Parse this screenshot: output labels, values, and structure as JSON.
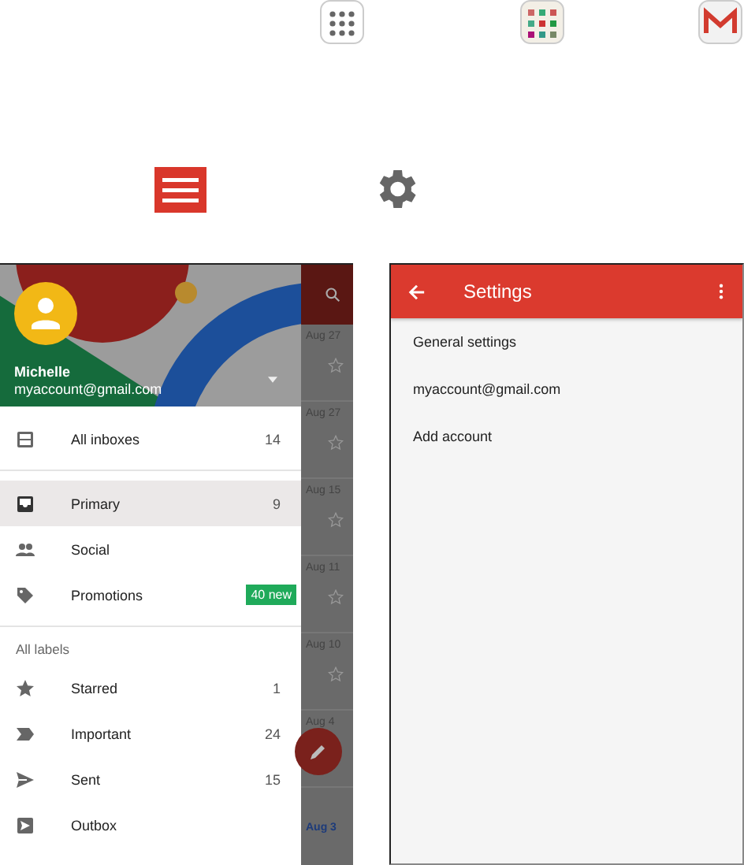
{
  "drawer": {
    "account": {
      "name": "Michelle",
      "email": "myaccount@gmail.com"
    },
    "groups": [
      {
        "items": [
          {
            "label": "All inboxes",
            "count": "14",
            "selected": false
          }
        ]
      },
      {
        "items": [
          {
            "label": "Primary",
            "count": "9",
            "selected": true
          },
          {
            "label": "Social",
            "selected": false
          },
          {
            "label": "Promotions",
            "badge": "40 new",
            "selected": false
          }
        ]
      },
      {
        "heading": "All labels",
        "items": [
          {
            "label": "Starred",
            "count": "1",
            "selected": false
          },
          {
            "label": "Important",
            "count": "24",
            "selected": false
          },
          {
            "label": "Sent",
            "count": "15",
            "selected": false
          },
          {
            "label": "Outbox",
            "selected": false
          }
        ]
      }
    ]
  },
  "mail_list": {
    "dates": [
      "Aug 27",
      "Aug 27",
      "Aug 15",
      "Aug 11",
      "Aug 10",
      "Aug 4",
      "Aug 3"
    ]
  },
  "settings": {
    "title": "Settings",
    "items": [
      "General settings",
      "myaccount@gmail.com",
      "Add account"
    ]
  }
}
